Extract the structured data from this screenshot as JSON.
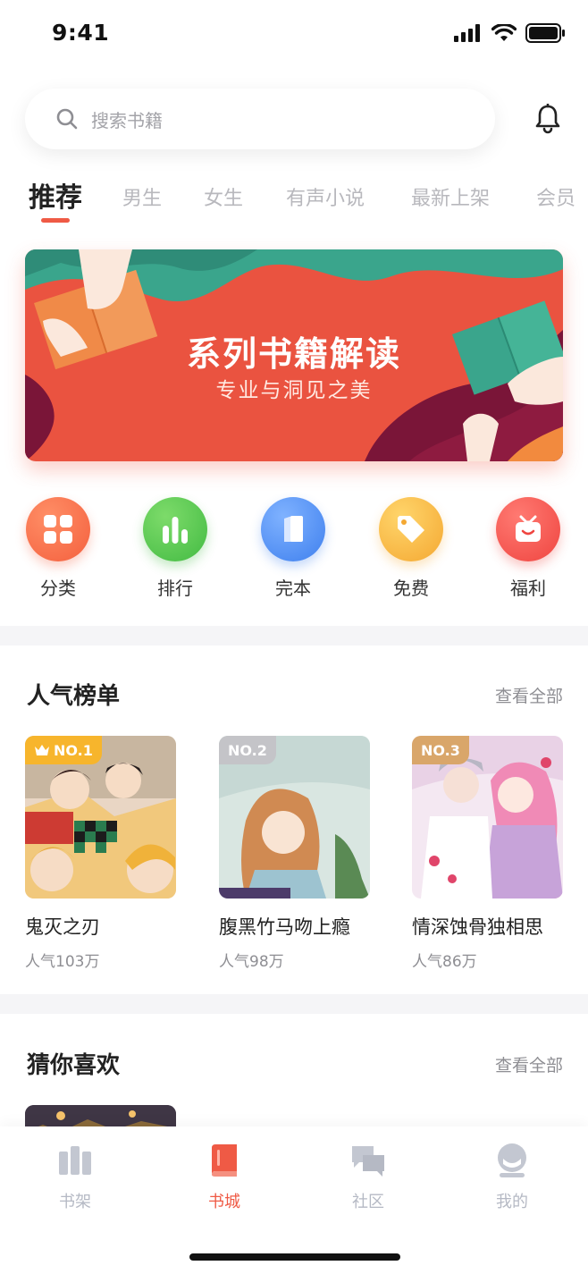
{
  "status": {
    "time": "9:41"
  },
  "search": {
    "placeholder": "搜索书籍"
  },
  "tabs": [
    {
      "label": "推荐",
      "active": true
    },
    {
      "label": "男生"
    },
    {
      "label": "女生"
    },
    {
      "label": "有声小说"
    },
    {
      "label": "最新上架"
    },
    {
      "label": "会员"
    }
  ],
  "banner": {
    "title": "系列书籍解读",
    "subtitle": "专业与洞见之美"
  },
  "quick_entries": [
    {
      "label": "分类",
      "icon": "grid-icon",
      "color": "#f86a45"
    },
    {
      "label": "排行",
      "icon": "bar-chart-icon",
      "color": "#52c74d"
    },
    {
      "label": "完本",
      "icon": "book-icon",
      "color": "#4f8ff2"
    },
    {
      "label": "免费",
      "icon": "tag-icon",
      "color": "#f6b03f"
    },
    {
      "label": "福利",
      "icon": "gift-icon",
      "color": "#f2504d"
    }
  ],
  "popular": {
    "title": "人气榜单",
    "more": "查看全部",
    "books": [
      {
        "rank": "NO.1",
        "title": "鬼灭之刃",
        "popularity": "人气103万",
        "badge_color": "#f7b52c"
      },
      {
        "rank": "NO.2",
        "title": "腹黑竹马吻上瘾",
        "popularity": "人气98万",
        "badge_color": "#c4c4c8"
      },
      {
        "rank": "NO.3",
        "title": "情深蚀骨独相思",
        "popularity": "人气86万",
        "badge_color": "#d9a66a"
      }
    ]
  },
  "guess": {
    "title": "猜你喜欢",
    "more": "查看全部"
  },
  "bottom_nav": [
    {
      "label": "书架",
      "icon": "bookshelf-icon"
    },
    {
      "label": "书城",
      "icon": "bookstore-icon",
      "active": true
    },
    {
      "label": "社区",
      "icon": "community-icon"
    },
    {
      "label": "我的",
      "icon": "profile-icon"
    }
  ],
  "colors": {
    "accent": "#ef5a45",
    "inactive": "#b5b9c4"
  }
}
